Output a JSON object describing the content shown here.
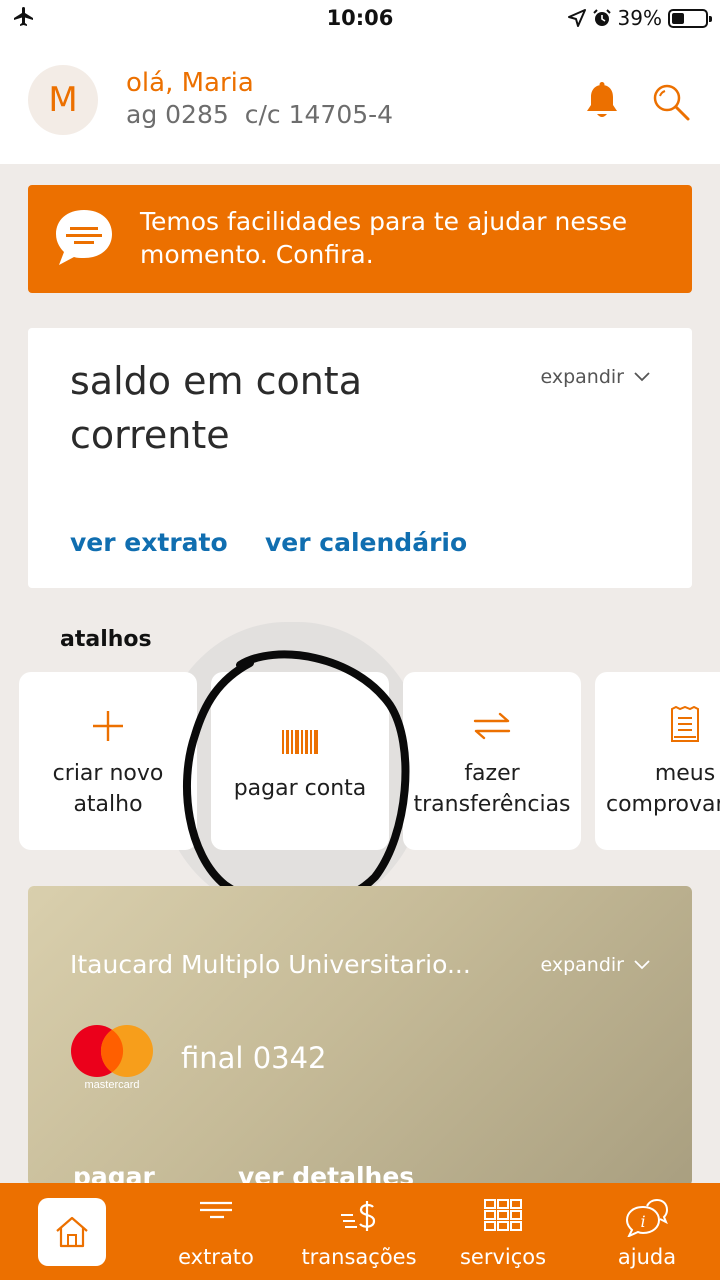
{
  "status_bar": {
    "time": "10:06",
    "battery": "39%",
    "battery_level": 0.39
  },
  "header": {
    "avatar_initial": "M",
    "greeting": "olá, Maria",
    "agency": "ag 0285",
    "account": "c/c 14705-4",
    "icons": [
      "bell-icon",
      "search-icon"
    ]
  },
  "banner": {
    "text": "Temos facilidades para te ajudar nesse momento. Confira."
  },
  "balance": {
    "title": "saldo em conta corrente",
    "expand_label": "expandir",
    "links": [
      "ver extrato",
      "ver calendário"
    ]
  },
  "shortcuts": {
    "title": "atalhos",
    "items": [
      {
        "label_line1": "criar novo",
        "label_line2": "atalho",
        "icon": "plus-icon"
      },
      {
        "label_line1": "pagar conta",
        "label_line2": "",
        "icon": "barcode-icon"
      },
      {
        "label_line1": "fazer",
        "label_line2": "transferências",
        "icon": "transfer-arrows-icon"
      },
      {
        "label_line1": "meus",
        "label_line2": "comprovantes",
        "icon": "receipt-icon"
      }
    ]
  },
  "credit_card": {
    "name": "Itaucard Multiplo Universitario...",
    "expand_label": "expandir",
    "brand": "mastercard",
    "final": "final 0342",
    "links": [
      "pagar",
      "ver detalhes"
    ]
  },
  "bottom_nav": {
    "items": [
      {
        "label": "extrato",
        "icon": "statement-lines-icon"
      },
      {
        "label": "transações",
        "icon": "dollar-transfer-icon"
      },
      {
        "label": "serviços",
        "icon": "grid-icon"
      },
      {
        "label": "ajuda",
        "icon": "help-chat-icon"
      }
    ]
  },
  "colors": {
    "accent": "#ec7000",
    "link": "#106eb0",
    "background": "#efebe8"
  }
}
